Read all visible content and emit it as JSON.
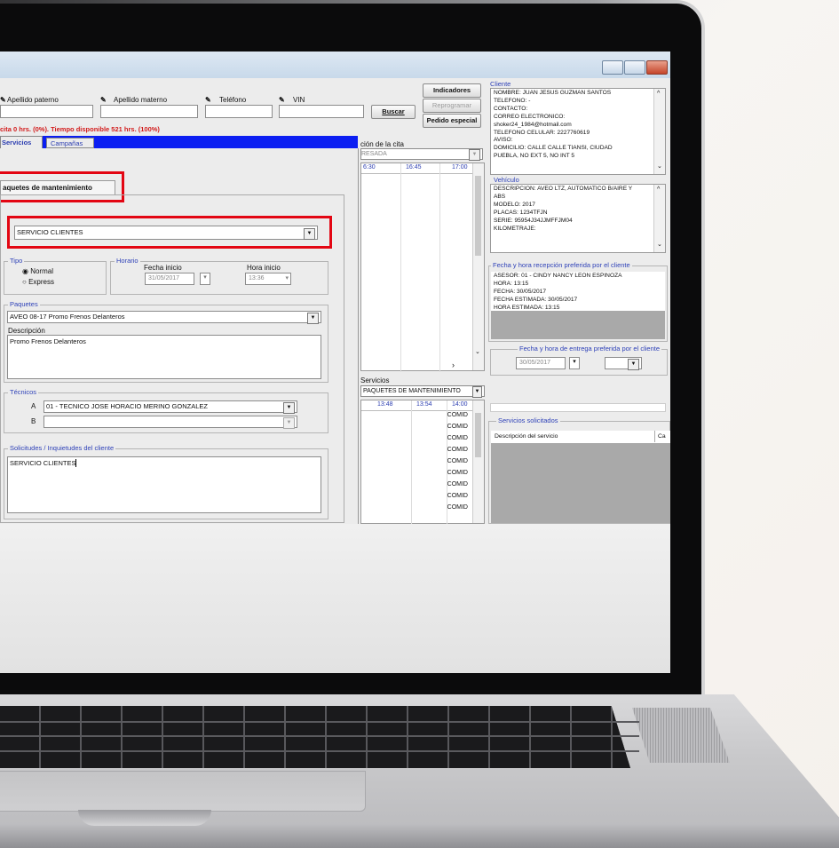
{
  "search": {
    "fields": [
      "Apellido paterno",
      "Apellido materno",
      "Teléfono",
      "VIN"
    ],
    "buscar_label": "Buscar",
    "indicadores_label": "Indicadores",
    "reprogramar_label": "Reprogramar",
    "pedido_label": "Pedido especial"
  },
  "status_text": "cita 0 hrs. (0%). Tiempo disponible 521 hrs. (100%)",
  "tabs": [
    "Servicios",
    "Campañas"
  ],
  "subtab": "aquetes de mantenimiento",
  "servicio_select": "SERVICIO CLIENTES",
  "tipo": {
    "title": "Tipo",
    "options": [
      "Normal",
      "Express"
    ],
    "selected": "Normal"
  },
  "horario": {
    "title": "Horario",
    "fecha_label": "Fecha inicio",
    "fecha_value": "31/05/2017",
    "hora_label": "Hora inicio",
    "hora_value": "13:36"
  },
  "paquetes": {
    "title": "Paquetes",
    "selected": "AVEO 08-17 Promo Frenos Delanteros",
    "desc_label": "Descripción",
    "description": "Promo Frenos Delanteros"
  },
  "tecnicos": {
    "title": "Técnicos",
    "a_label": "A",
    "a_value": "01 - TECNICO JOSE HORACIO MERINO GONZALEZ",
    "b_label": "B",
    "b_value": ""
  },
  "solicitudes": {
    "title": "Solicitudes / Inquietudes del cliente",
    "value": "SERVICIO CLIENTES"
  },
  "schedule": {
    "title": "ción de la cita",
    "select": "RESADA",
    "times": [
      "6:30",
      "16:45",
      "17:00"
    ],
    "servicios_label": "Servicios",
    "servicios_select": "PAQUETES DE MANTENIMIENTO",
    "times2": [
      "13:48",
      "13:54",
      "14:00"
    ],
    "comid": [
      "COMID",
      "COMID",
      "COMID",
      "COMID",
      "COMID",
      "COMID",
      "COMID",
      "COMID",
      "COMID"
    ]
  },
  "cliente": {
    "title": "Cliente",
    "lines": [
      "NOMBRE: JUAN JESUS GUZMAN SANTOS",
      "TELEFONO: -",
      "CONTACTO:",
      "CORREO ELECTRONICO:",
      "shoker24_1984@hotmail.com",
      "TELEFONO CELULAR: 2227760619",
      "AVISO:",
      "DOMICILIO: CALLE CALLE TIANSI, CIUDAD",
      "PUEBLA, NO EXT 5, NO INT 5"
    ]
  },
  "vehiculo": {
    "title": "Vehículo",
    "lines": [
      "DESCRIPCION: AVEO LTZ, AUTOMATICO B/AIRE Y",
      "ABS",
      "MODELO: 2017",
      "PLACAS: 1234TFJN",
      "SERIE: 95954J34JJMFFJM04",
      "KILOMETRAJE:"
    ]
  },
  "recepcion": {
    "title": "Fecha y hora recepción preferida por el cliente",
    "lines": [
      "ASESOR: 01 - CINDY NANCY LEON ESPINOZA",
      "HORA: 13:15",
      "FECHA: 30/05/2017",
      "FECHA ESTIMADA: 30/05/2017",
      "HORA ESTIMADA: 13:15"
    ]
  },
  "entrega": {
    "title": "Fecha y hora de entrega preferida por el cliente",
    "fecha": "30/05/2017"
  },
  "solicitados": {
    "title": "Servicios solicitados",
    "col1": "Descripción del servicio",
    "col2": "Ca"
  },
  "colors": {
    "accent_blue": "#0b1ef2",
    "highlight_red": "#e30613",
    "status_red": "#d21b1b"
  }
}
